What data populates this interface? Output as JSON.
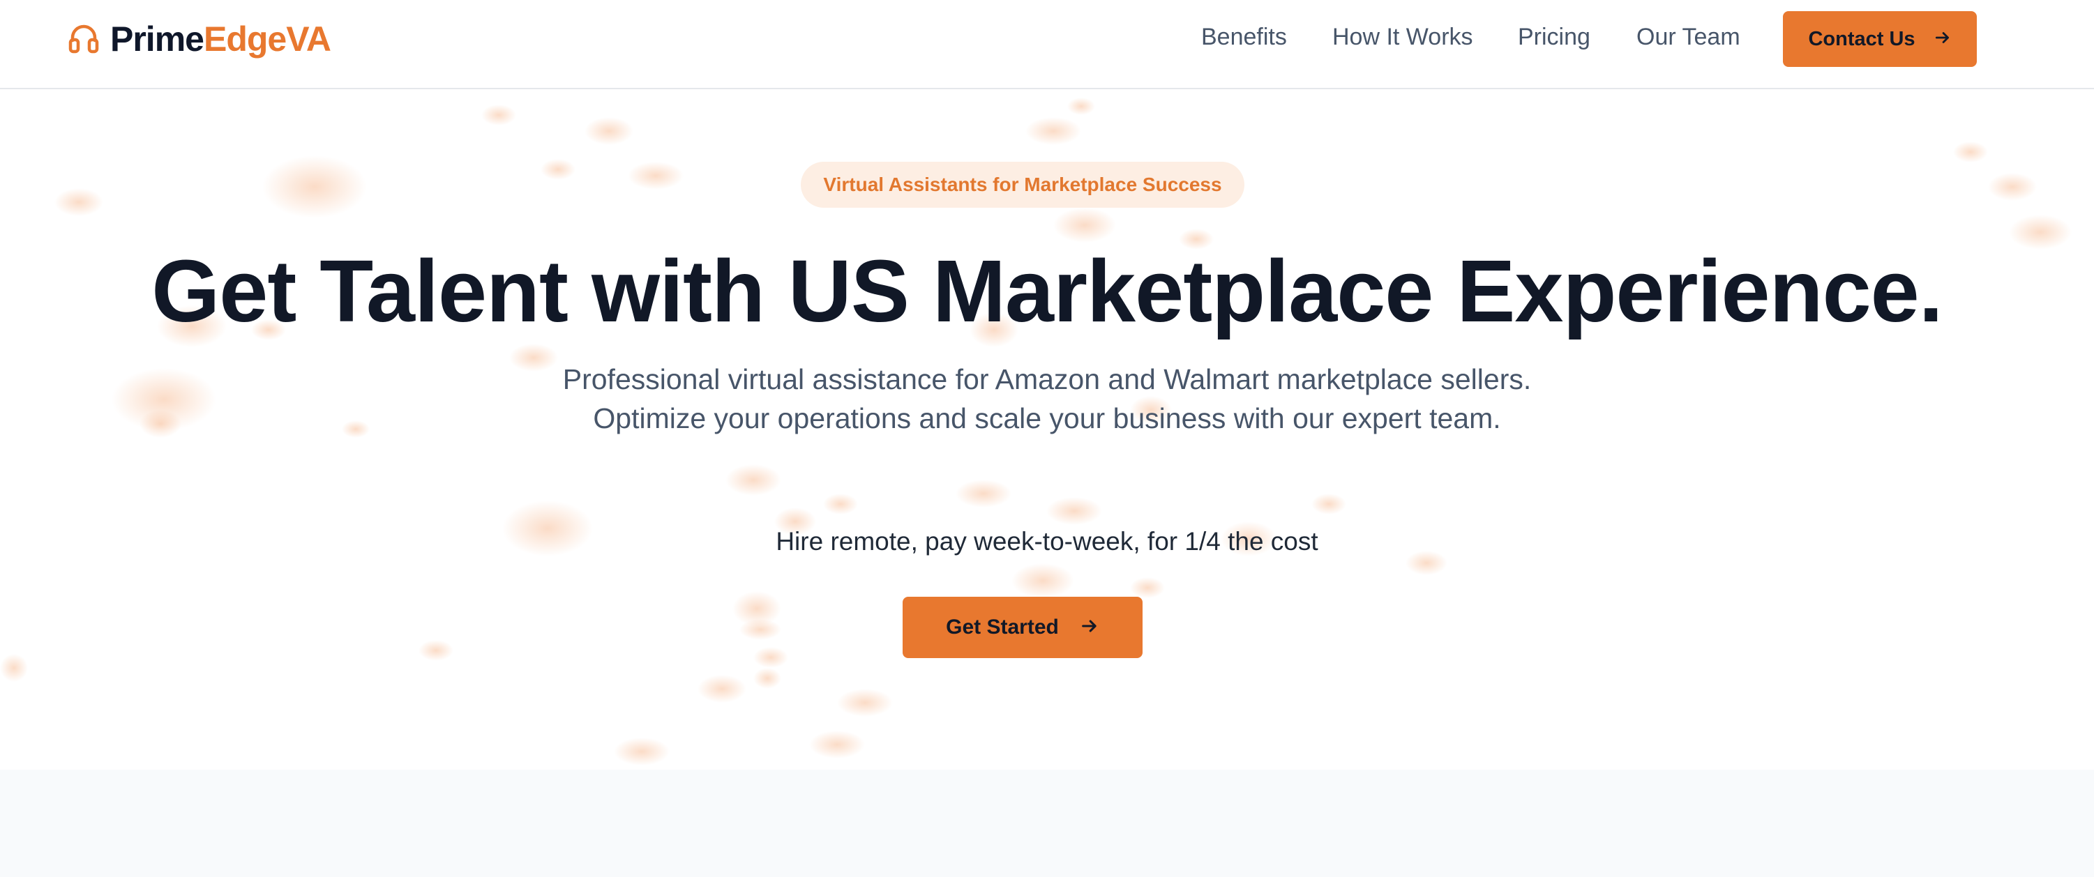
{
  "brand": {
    "name_part1": "Prime",
    "name_part2": "EdgeVA",
    "accent_color": "#e8782f",
    "icon": "headset-icon"
  },
  "nav": {
    "links": [
      {
        "label": "Benefits"
      },
      {
        "label": "How It Works"
      },
      {
        "label": "Pricing"
      },
      {
        "label": "Our Team"
      }
    ],
    "contact_button": {
      "label": "Contact Us",
      "icon": "arrow-right-icon"
    }
  },
  "hero": {
    "badge": "Virtual Assistants for Marketplace Success",
    "headline": "Get Talent with US Marketplace Experience.",
    "description": "Professional virtual assistance for Amazon and Walmart marketplace sellers. Optimize your operations and scale your business with our expert team.",
    "tagline": "Hire remote, pay week-to-week, for 1/4 the cost",
    "cta": {
      "label": "Get Started",
      "icon": "arrow-right-icon"
    }
  },
  "colors": {
    "accent": "#e8782f",
    "headline": "#111827",
    "body_text": "#475569",
    "badge_bg": "#fdeee3",
    "lower_section_bg": "#f8fafc"
  }
}
